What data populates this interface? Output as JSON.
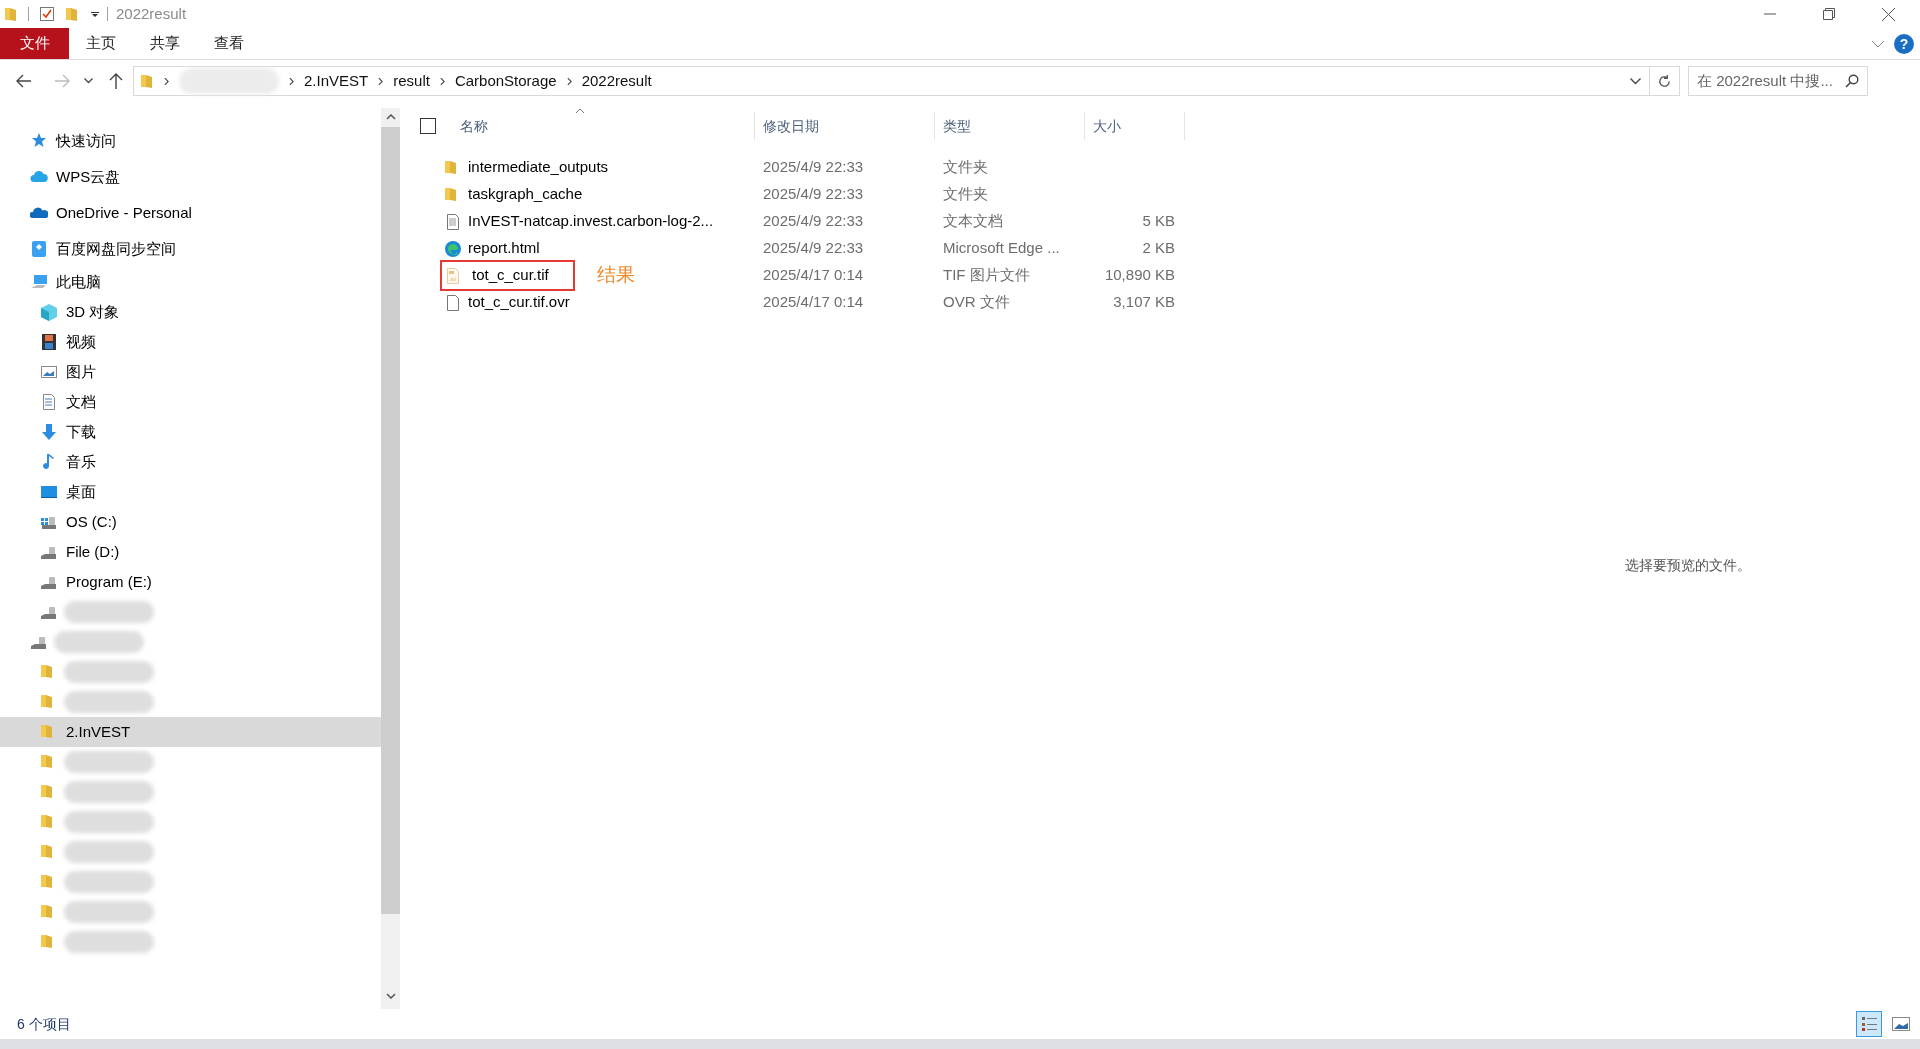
{
  "window": {
    "title": "2022result",
    "help_label": "?"
  },
  "ribbon_tabs": [
    {
      "label": "文件",
      "kind": "file"
    },
    {
      "label": "主页",
      "kind": "tab"
    },
    {
      "label": "共享",
      "kind": "tab"
    },
    {
      "label": "查看",
      "kind": "tab"
    }
  ],
  "address_bar": {
    "segments": [
      {
        "kind": "redacted"
      },
      {
        "kind": "text",
        "label": "2.InVEST"
      },
      {
        "kind": "text",
        "label": "result"
      },
      {
        "kind": "text",
        "label": "CarbonStorage"
      },
      {
        "kind": "text",
        "label": "2022result"
      }
    ]
  },
  "search": {
    "placeholder": "在 2022result 中搜..."
  },
  "sidebar": {
    "items": [
      {
        "label": "快速访问",
        "kind": "star",
        "selected": false
      },
      {
        "label": "WPS云盘",
        "kind": "cloud",
        "selected": false
      },
      {
        "label": "OneDrive - Personal",
        "kind": "onedrive",
        "selected": false
      },
      {
        "label": "百度网盘同步空间",
        "kind": "baidu",
        "selected": false
      },
      {
        "label": "此电脑",
        "kind": "pc",
        "selected": false,
        "children": [
          {
            "label": "3D 对象",
            "kind": "cube",
            "selected": false
          },
          {
            "label": "视频",
            "kind": "video",
            "selected": false
          },
          {
            "label": "图片",
            "kind": "image",
            "selected": false
          },
          {
            "label": "文档",
            "kind": "doc",
            "selected": false
          },
          {
            "label": "下载",
            "kind": "download",
            "selected": false
          },
          {
            "label": "音乐",
            "kind": "music",
            "selected": false
          },
          {
            "label": "桌面",
            "kind": "desktop",
            "selected": false
          },
          {
            "label": "OS (C:)",
            "kind": "osdrive",
            "selected": false
          },
          {
            "label": "File (D:)",
            "kind": "drive",
            "selected": false
          },
          {
            "label": "Program (E:)",
            "kind": "drive",
            "selected": false
          },
          {
            "kind": "drive",
            "selected": false
          }
        ]
      },
      {
        "kind": "drive",
        "selected": false,
        "children": [
          {
            "kind": "folder",
            "selected": false
          },
          {
            "kind": "folder",
            "selected": false
          },
          {
            "label": "2.InVEST",
            "kind": "folder",
            "selected": true
          },
          {
            "kind": "folder",
            "selected": false
          },
          {
            "kind": "folder",
            "selected": false
          },
          {
            "kind": "folder",
            "selected": false
          },
          {
            "kind": "folder",
            "selected": false
          },
          {
            "kind": "folder",
            "selected": false
          },
          {
            "kind": "folder",
            "selected": false
          },
          {
            "kind": "folder",
            "selected": false
          }
        ]
      }
    ]
  },
  "file_list": {
    "select_all_checked": false,
    "columns": [
      "名称",
      "修改日期",
      "类型",
      "大小"
    ],
    "rows": [
      {
        "name": "intermediate_outputs",
        "modified": "2025/4/9 22:33",
        "type": "文件夹",
        "kind": "folder"
      },
      {
        "name": "taskgraph_cache",
        "modified": "2025/4/9 22:33",
        "type": "文件夹",
        "kind": "folder"
      },
      {
        "name": "InVEST-natcap.invest.carbon-log-2...",
        "modified": "2025/4/9 22:33",
        "type": "文本文档",
        "size": "5 KB",
        "kind": "text"
      },
      {
        "name": "report.html",
        "modified": "2025/4/9 22:33",
        "type": "Microsoft Edge ...",
        "size": "2 KB",
        "kind": "edge"
      },
      {
        "name": "tot_c_cur.tif",
        "modified": "2025/4/17 0:14",
        "type": "TIF 图片文件",
        "size": "10,890 KB",
        "kind": "tif",
        "annotation": "结果"
      },
      {
        "name": "tot_c_cur.tif.ovr",
        "modified": "2025/4/17 0:14",
        "type": "OVR 文件",
        "size": "3,107 KB",
        "kind": "file"
      }
    ]
  },
  "preview": {
    "message": "选择要预览的文件。"
  },
  "status_bar": {
    "item_count": "6 个项目",
    "views": [
      {
        "kind": "details",
        "selected": true
      },
      {
        "kind": "preview",
        "selected": false
      }
    ]
  }
}
